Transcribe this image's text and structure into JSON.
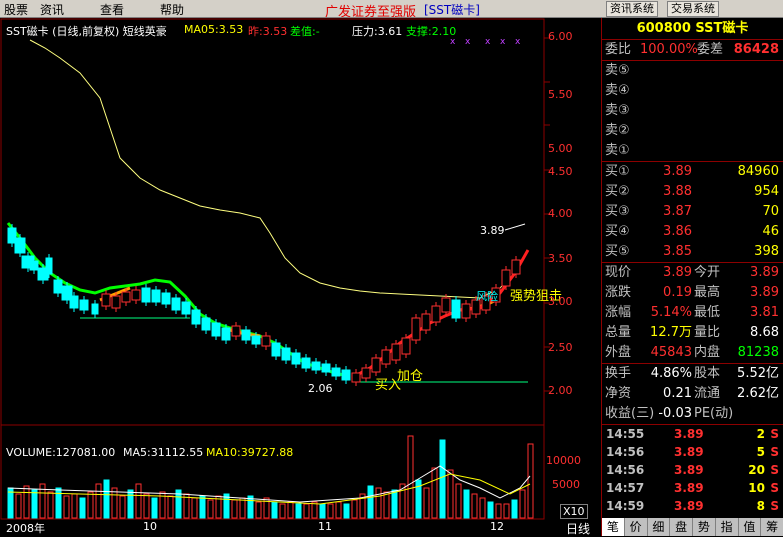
{
  "menu": {
    "items": [
      "股票",
      "资讯",
      "查看",
      "帮助"
    ],
    "title": "广发证券至强版",
    "subtitle": "[SST磁卡]",
    "buttons": [
      "资讯系统",
      "交易系统"
    ]
  },
  "kline": {
    "title": "SST磁卡 (日线,前复权) 短线英豪",
    "ma05": "MA05:3.53",
    "zha": "昨:3.53",
    "chazhi": "差值:-",
    "yali": "压力:3.61",
    "zhicheng": "支撑:2.10"
  },
  "axis": {
    "price_ticks": [
      "6.00",
      "5.50",
      "5.00",
      "4.50",
      "4.00",
      "3.50",
      "3.00",
      "2.50",
      "2.00"
    ],
    "vol_ticks": [
      "10000",
      "5000"
    ],
    "vol_unit": "X10",
    "months": [
      "2008年",
      "10",
      "11",
      "12"
    ],
    "period": "日线"
  },
  "annotations": {
    "high": "3.89",
    "low": "2.06",
    "buy": "买入",
    "add": "加仓",
    "strong": "强势狙击",
    "wind": "风险"
  },
  "volume": {
    "vol": "VOLUME:127081.00",
    "ma5": "MA5:31112.55",
    "ma10": "MA10:39727.88"
  },
  "quote": {
    "code": "600800 SST磁卡",
    "weibi_label": "委比",
    "weibi": "100.00%",
    "weicha_label": "委差",
    "weicha": "86428",
    "sells": [
      {
        "label": "卖⑤"
      },
      {
        "label": "卖④"
      },
      {
        "label": "卖③"
      },
      {
        "label": "卖②"
      },
      {
        "label": "卖①"
      }
    ],
    "buys": [
      {
        "label": "买①",
        "price": "3.89",
        "vol": "84960"
      },
      {
        "label": "买②",
        "price": "3.88",
        "vol": "954"
      },
      {
        "label": "买③",
        "price": "3.87",
        "vol": "70"
      },
      {
        "label": "买④",
        "price": "3.86",
        "vol": "46"
      },
      {
        "label": "买⑤",
        "price": "3.85",
        "vol": "398"
      }
    ],
    "stats": [
      {
        "l": "现价",
        "v": "3.89",
        "l2": "今开",
        "v2": "3.89"
      },
      {
        "l": "涨跌",
        "v": "0.19",
        "l2": "最高",
        "v2": "3.89"
      },
      {
        "l": "涨幅",
        "v": "5.14%",
        "l2": "最低",
        "v2": "3.81"
      },
      {
        "l": "总量",
        "v": "12.7万",
        "l2": "量比",
        "v2": "8.68"
      },
      {
        "l": "外盘",
        "v": "45843",
        "l2": "内盘",
        "v2": "81238"
      }
    ],
    "stats2": [
      {
        "l": "换手",
        "v": "4.86%",
        "l2": "股本",
        "v2": "5.52亿"
      },
      {
        "l": "净资",
        "v": "0.21",
        "l2": "流通",
        "v2": "2.62亿"
      },
      {
        "l": "收益(三)",
        "v": "-0.03",
        "l2": "PE(动)",
        "v2": ""
      }
    ],
    "ticks": [
      {
        "t": "14:55",
        "p": "3.89",
        "v": "2",
        "d": "S"
      },
      {
        "t": "14:56",
        "p": "3.89",
        "v": "5",
        "d": "S"
      },
      {
        "t": "14:56",
        "p": "3.89",
        "v": "20",
        "d": "S"
      },
      {
        "t": "14:57",
        "p": "3.89",
        "v": "10",
        "d": "S"
      },
      {
        "t": "14:59",
        "p": "3.89",
        "v": "8",
        "d": "S"
      }
    ],
    "tabs": [
      "笔",
      "价",
      "细",
      "盘",
      "势",
      "指",
      "值",
      "筹"
    ]
  },
  "colors": {
    "up": "#ff3030",
    "down": "#00ffff",
    "ma_long": "#ffff80",
    "ma_green": "#00ff00"
  }
}
